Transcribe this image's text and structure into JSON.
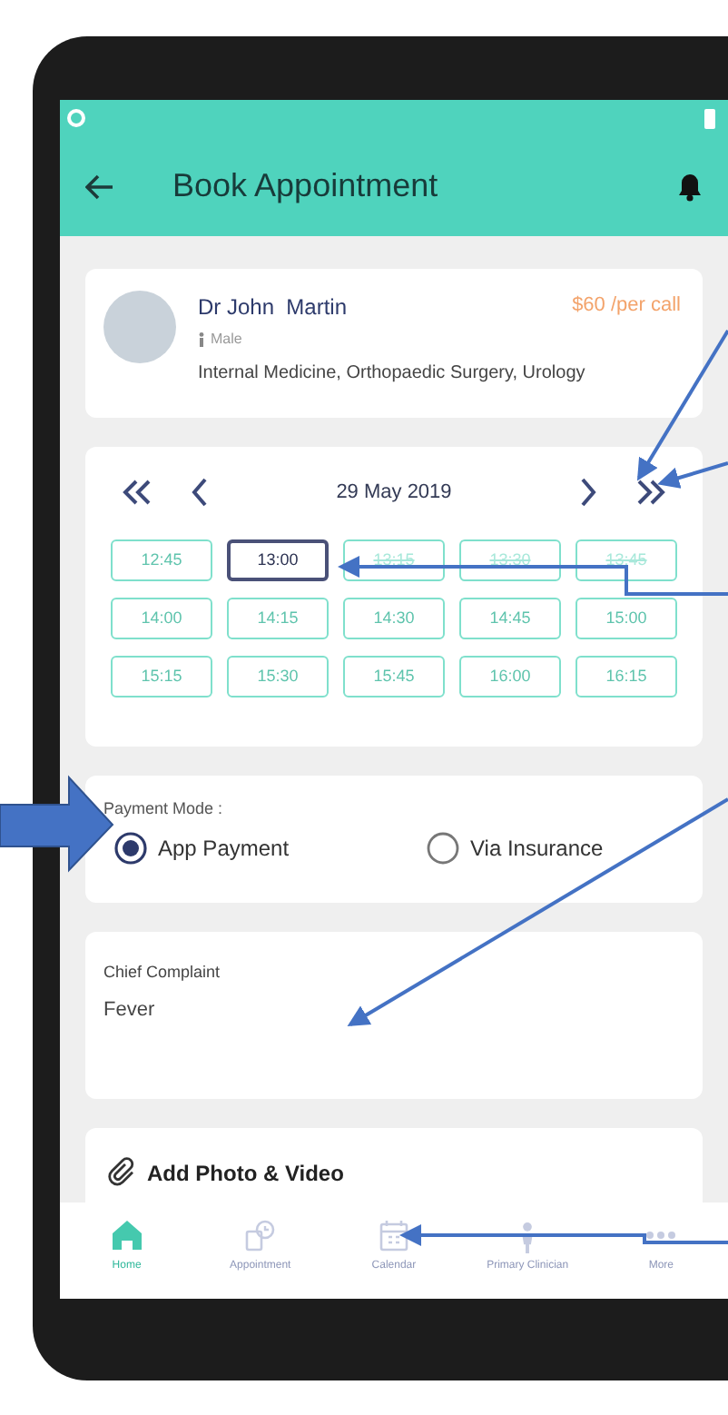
{
  "app_bar": {
    "title": "Book Appointment"
  },
  "doctor": {
    "name": "Dr John  Martin",
    "price": "$60 /per call",
    "gender": "Male",
    "specialties": "Internal Medicine, Orthopaedic Surgery, Urology"
  },
  "date_picker": {
    "date": "29 May 2019"
  },
  "time_slots": [
    {
      "label": "12:45",
      "selected": false,
      "disabled": false
    },
    {
      "label": "13:00",
      "selected": true,
      "disabled": false
    },
    {
      "label": "13:15",
      "selected": false,
      "disabled": true
    },
    {
      "label": "13:30",
      "selected": false,
      "disabled": true
    },
    {
      "label": "13:45",
      "selected": false,
      "disabled": true
    },
    {
      "label": "14:00",
      "selected": false,
      "disabled": false
    },
    {
      "label": "14:15",
      "selected": false,
      "disabled": false
    },
    {
      "label": "14:30",
      "selected": false,
      "disabled": false
    },
    {
      "label": "14:45",
      "selected": false,
      "disabled": false
    },
    {
      "label": "15:00",
      "selected": false,
      "disabled": false
    },
    {
      "label": "15:15",
      "selected": false,
      "disabled": false
    },
    {
      "label": "15:30",
      "selected": false,
      "disabled": false
    },
    {
      "label": "15:45",
      "selected": false,
      "disabled": false
    },
    {
      "label": "16:00",
      "selected": false,
      "disabled": false
    },
    {
      "label": "16:15",
      "selected": false,
      "disabled": false
    }
  ],
  "payment": {
    "label": "Payment Mode :",
    "options": [
      {
        "label": "App Payment",
        "selected": true
      },
      {
        "label": "Via Insurance",
        "selected": false
      }
    ]
  },
  "complaint": {
    "label": "Chief Complaint",
    "value": "Fever"
  },
  "attachment": {
    "label": "Add Photo & Video"
  },
  "bottom_nav": [
    {
      "label": "Home",
      "kind": "home",
      "selected": true
    },
    {
      "label": "Appointment",
      "kind": "appointment",
      "selected": false
    },
    {
      "label": "Calendar",
      "kind": "calendar",
      "selected": false
    },
    {
      "label": "Primary Clinician",
      "kind": "clinician",
      "selected": false
    },
    {
      "label": "More",
      "kind": "more",
      "selected": false
    }
  ]
}
